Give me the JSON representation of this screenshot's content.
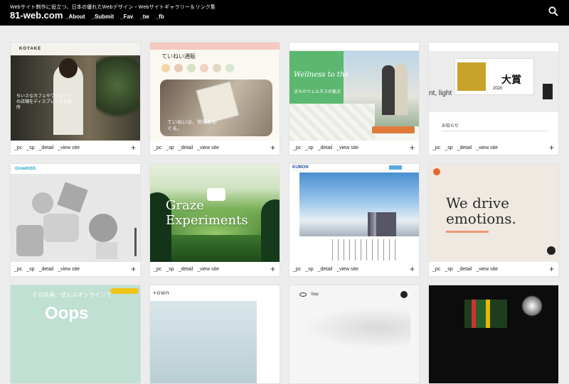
{
  "header": {
    "tagline": "Webサイト制作に役立つ、日本の優れたWebデザイン・Webサイトギャラリー＆リンク集",
    "logo": "81-web.com",
    "nav": [
      "_About",
      "_Submit",
      "_Fav",
      "_tw",
      "_fb"
    ]
  },
  "card_links": [
    "_pc",
    "_sp",
    "_detail",
    "_view site"
  ],
  "plus": "+",
  "cards": [
    {
      "brand": "KOYAKE",
      "caption": "ちいさなカフェやワインバーの店舗をディスプレイする場所"
    },
    {
      "title": "ていねい通販",
      "caption": "ていねいは、世界をめぐる。"
    },
    {
      "title": "Wellness to the",
      "sub": "まちのウェルネスの拠点"
    },
    {
      "badge": "大賞",
      "note": "2020",
      "text": "nt, light",
      "label": "お知らせ"
    },
    {
      "brand": "GrowthSS"
    },
    {
      "title": "Graze Experiments"
    },
    {
      "brand": "KUMON"
    },
    {
      "title": "We drive emotions."
    },
    {
      "title": "Oops",
      "sub": "その計画、ぜんぶオンラインで"
    },
    {
      "brand": "+own"
    },
    {
      "brand": "Sep"
    },
    {
      "brand": ""
    }
  ]
}
